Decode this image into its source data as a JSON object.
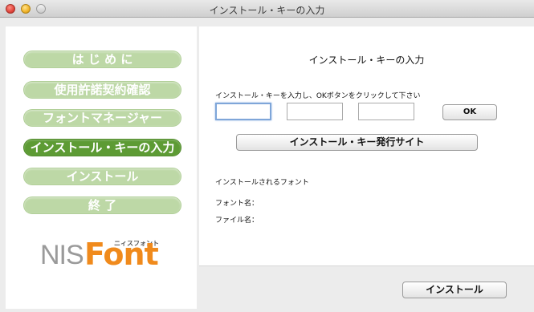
{
  "window": {
    "title": "インストール・キーの入力"
  },
  "sidebar": {
    "items": [
      {
        "label": "は じ め に",
        "active": false
      },
      {
        "label": "使用許諾契約確認",
        "active": false
      },
      {
        "label": "フォントマネージャー",
        "active": false
      },
      {
        "label": "インストール・キーの入力",
        "active": true
      },
      {
        "label": "インストール",
        "active": false
      },
      {
        "label": "終 了",
        "active": false
      }
    ]
  },
  "logo": {
    "nis": "NIS",
    "font": "Font",
    "small": "ニィスフォント"
  },
  "main": {
    "title": "インストール・キーの入力",
    "instruction": "インストール・キーを入力し、OKボタンをクリックして下さい",
    "key_fields": [
      {
        "value": "",
        "focused": true
      },
      {
        "value": "",
        "focused": false
      },
      {
        "value": "",
        "focused": false
      }
    ],
    "ok_label": "OK",
    "site_button_label": "インストール・キー発行サイト",
    "installed_fonts_heading": "インストールされるフォント",
    "font_name_label": "フォント名：",
    "file_name_label": "ファイル名："
  },
  "footer": {
    "install_label": "インストール"
  },
  "colors": {
    "nav_inactive": "#bdd8a6",
    "nav_active": "#5d9b34",
    "logo_orange": "#f08a1c",
    "logo_gray": "#9a9a9a"
  }
}
